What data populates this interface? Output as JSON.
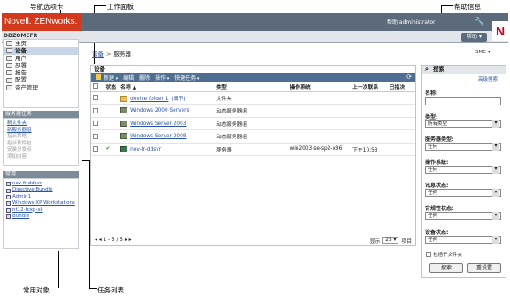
{
  "callouts": {
    "nav_tabs": "导航选项卡",
    "work_panel": "工作面板",
    "help_info": "帮助信息",
    "favorites": "常用对象",
    "task_list": "任务列表"
  },
  "header": {
    "brand": "Novell. ZENworks.",
    "user": "帮助 administrator",
    "server": "DDZOMEFR",
    "help_button": "帮助",
    "wrench_icon": "wrench-icon",
    "logo_letter": "N"
  },
  "nav": {
    "items": [
      {
        "label": "主页",
        "icon": "home-icon"
      },
      {
        "label": "设备",
        "icon": "devices-icon",
        "active": true
      },
      {
        "label": "用户",
        "icon": "users-icon"
      },
      {
        "label": "部署",
        "icon": "deploy-icon"
      },
      {
        "label": "报告",
        "icon": "reports-icon"
      },
      {
        "label": "配置",
        "icon": "config-icon"
      },
      {
        "label": "资产管理",
        "icon": "asset-icon"
      }
    ]
  },
  "tasks": {
    "title": "服务器任务",
    "items": [
      {
        "label": "新文件夹",
        "link": true
      },
      {
        "label": "新服务器组",
        "link": true
      },
      {
        "label": "指派策略",
        "link": false
      },
      {
        "label": "指派软件包",
        "link": false
      },
      {
        "label": "安装分发点",
        "link": false
      },
      {
        "label": "添加内容",
        "link": false
      }
    ]
  },
  "favorites": {
    "title": "常用",
    "items": [
      "nov-fr-ddsvr",
      "Directive Bundle",
      "Admin1",
      "Windows XP Workstations",
      "nt12-tcxp-sk",
      "Bundle"
    ]
  },
  "breadcrumb": {
    "root": "设备",
    "current": "服务器",
    "right_tag": "SMC ▾"
  },
  "devices": {
    "title": "设备",
    "toolbar": [
      "新建",
      "编辑",
      "删除",
      "操作",
      "快速任务"
    ],
    "columns": [
      "状态",
      "名称 ▲",
      "类型",
      "操作系统",
      "上一次联系",
      "已指决"
    ],
    "rows": [
      {
        "name": "device folder 1",
        "extra": "(细节)",
        "type": "文件夹",
        "os": "",
        "last": "",
        "icon": "folder"
      },
      {
        "name": "Windows 2000 Servers",
        "extra": "",
        "type": "动态服务器组",
        "os": "",
        "last": "",
        "icon": "group"
      },
      {
        "name": "Windows Server 2003",
        "extra": "",
        "type": "动态服务器组",
        "os": "",
        "last": "",
        "icon": "group"
      },
      {
        "name": "Windows Server 2008",
        "extra": "",
        "type": "动态服务器组",
        "os": "",
        "last": "",
        "icon": "group"
      },
      {
        "name": "nov-fr-ddsvr",
        "extra": "",
        "type": "服务器",
        "os": "win2003-se-sp2-x86",
        "last": "下午10:53",
        "icon": "server"
      }
    ],
    "footer_left": "1 - 5 / 5",
    "footer_show": "显示",
    "footer_per": "25 ▾",
    "footer_items": "项目"
  },
  "search": {
    "title": "搜索",
    "advanced": "高级搜索",
    "name_label": "名称:",
    "type_label": "类型:",
    "type_value": "所有类型",
    "server_type_label": "服务器类型:",
    "server_type_value": "任何",
    "os_label": "操作系统:",
    "os_value": "任何",
    "msg_label": "讯息状态:",
    "msg_value": "任何",
    "compliance_label": "合规性状态:",
    "compliance_value": "任何",
    "device_label": "设备状态:",
    "device_value": "任何",
    "include_sub": "包括子文件夹",
    "search_btn": "搜索",
    "reset_btn": "重设置"
  }
}
